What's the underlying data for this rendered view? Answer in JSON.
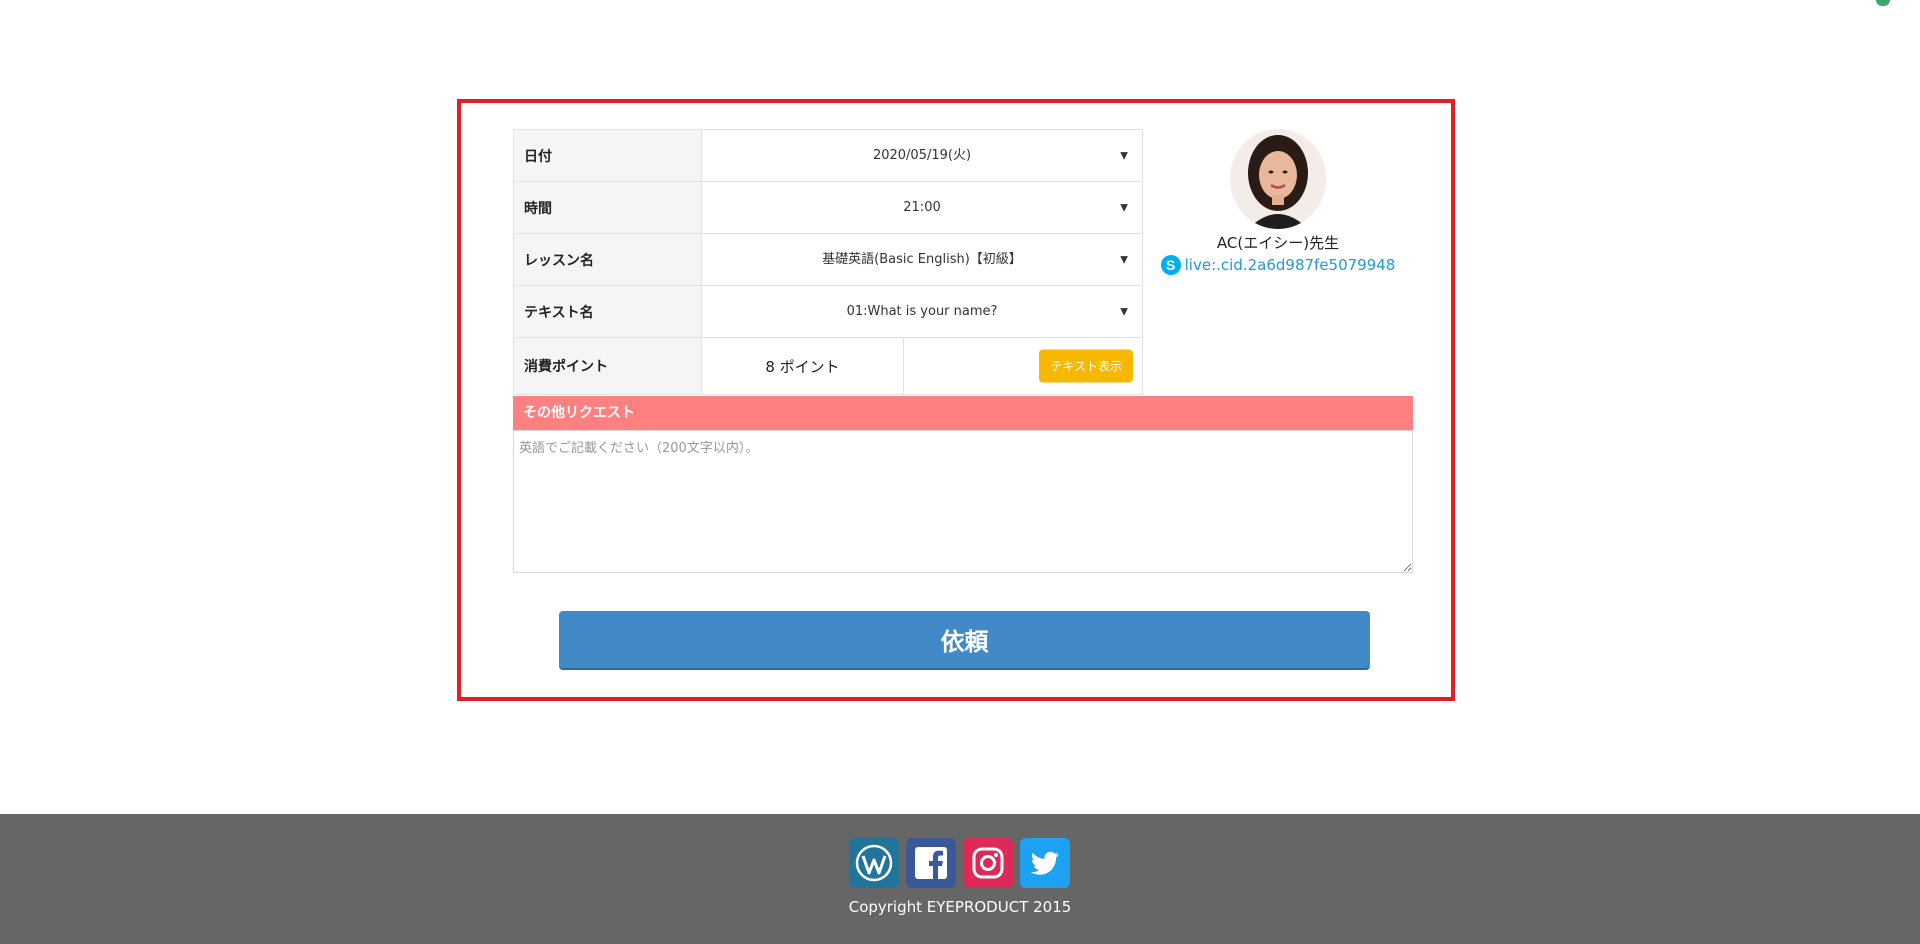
{
  "form": {
    "rows": [
      {
        "label": "日付",
        "value": "2020/05/19(火)"
      },
      {
        "label": "時間",
        "value": "21:00"
      },
      {
        "label": "レッスン名",
        "value": "基礎英語(Basic English)【初級】"
      },
      {
        "label": "テキスト名",
        "value": "01:What is your name?"
      }
    ],
    "points_label": "消費ポイント",
    "points_value": "8 ポイント",
    "text_show_label": "テキスト表示",
    "dropdown_arrow": "▼",
    "request_header": "その他リクエスト",
    "request_placeholder": "英語でご記載ください（200文字以内）。",
    "submit_label": "依頼"
  },
  "teacher": {
    "name": "AC(エイシー)先生",
    "skype_id": "live:.cid.2a6d987fe5079948",
    "skype_icon_letter": "S"
  },
  "footer": {
    "copyright": "Copyright EYEPRODUCT 2015",
    "icons": [
      "wordpress-icon",
      "facebook-icon",
      "instagram-icon",
      "twitter-icon"
    ]
  },
  "colors": {
    "frame_border": "#e31e24",
    "request_header": "#ff8080",
    "submit_button": "#4189c7",
    "text_show_button": "#f9b800",
    "footer_bg": "#666666",
    "link": "#1f9ad6"
  }
}
